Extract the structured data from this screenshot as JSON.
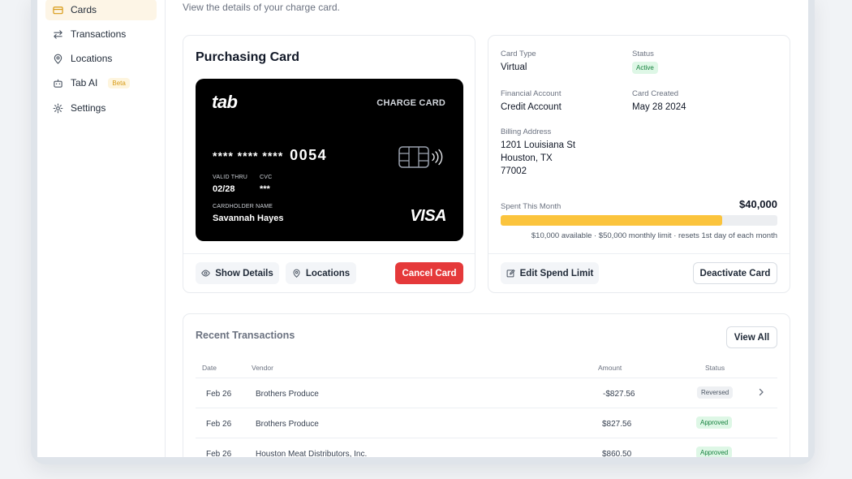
{
  "sidebar": {
    "items": [
      {
        "label": "Cards",
        "icon": "card-icon",
        "active": true
      },
      {
        "label": "Transactions",
        "icon": "transfer-icon"
      },
      {
        "label": "Locations",
        "icon": "location-pin-icon"
      },
      {
        "label": "Tab AI",
        "icon": "robot-icon",
        "badge": "Beta"
      },
      {
        "label": "Settings",
        "icon": "gear-icon"
      }
    ]
  },
  "page": {
    "subtitle": "View the details of your charge card."
  },
  "card_panel": {
    "title": "Purchasing Card",
    "card": {
      "logo": "tab",
      "kind": "CHARGE CARD",
      "masked": "**** **** ****",
      "last4": "0054",
      "valid_thru_label": "VALID THRU",
      "valid_thru": "02/28",
      "cvc_label": "CVC",
      "cvc": "***",
      "holder_label": "CARDHOLDER NAME",
      "holder": "Savannah Hayes",
      "network": "VISA"
    },
    "buttons": {
      "show_details": "Show Details",
      "locations": "Locations",
      "cancel": "Cancel Card"
    }
  },
  "info_panel": {
    "card_type_label": "Card Type",
    "card_type": "Virtual",
    "status_label": "Status",
    "status": "Active",
    "financial_account_label": "Financial Account",
    "financial_account": "Credit Account",
    "card_created_label": "Card Created",
    "card_created": "May 28 2024",
    "billing_label": "Billing Address",
    "billing_line1": "1201 Louisiana St",
    "billing_line2": "Houston, TX",
    "billing_line3": "77002",
    "spent_label": "Spent This Month",
    "spent_amount": "$40,000",
    "spent_fraction": 0.8,
    "limit_note": "$10,000 available · $50,000 monthly limit · resets 1st day of each month",
    "buttons": {
      "edit_limit": "Edit Spend Limit",
      "deactivate": "Deactivate Card"
    }
  },
  "transactions": {
    "title": "Recent Transactions",
    "view_all": "View All",
    "columns": {
      "date": "Date",
      "vendor": "Vendor",
      "amount": "Amount",
      "status": "Status"
    },
    "rows": [
      {
        "date": "Feb 26",
        "vendor": "Brothers Produce",
        "amount": "-$827.56",
        "status": "Reversed"
      },
      {
        "date": "Feb 26",
        "vendor": "Brothers Produce",
        "amount": "$827.56",
        "status": "Approved"
      },
      {
        "date": "Feb 26",
        "vendor": "Houston Meat Distributors, Inc.",
        "amount": "$860.50",
        "status": "Approved"
      }
    ]
  },
  "colors": {
    "accent": "#fbc43d",
    "danger": "#e5393a",
    "success": "#15803d",
    "active_nav": "#fdf5e6"
  }
}
